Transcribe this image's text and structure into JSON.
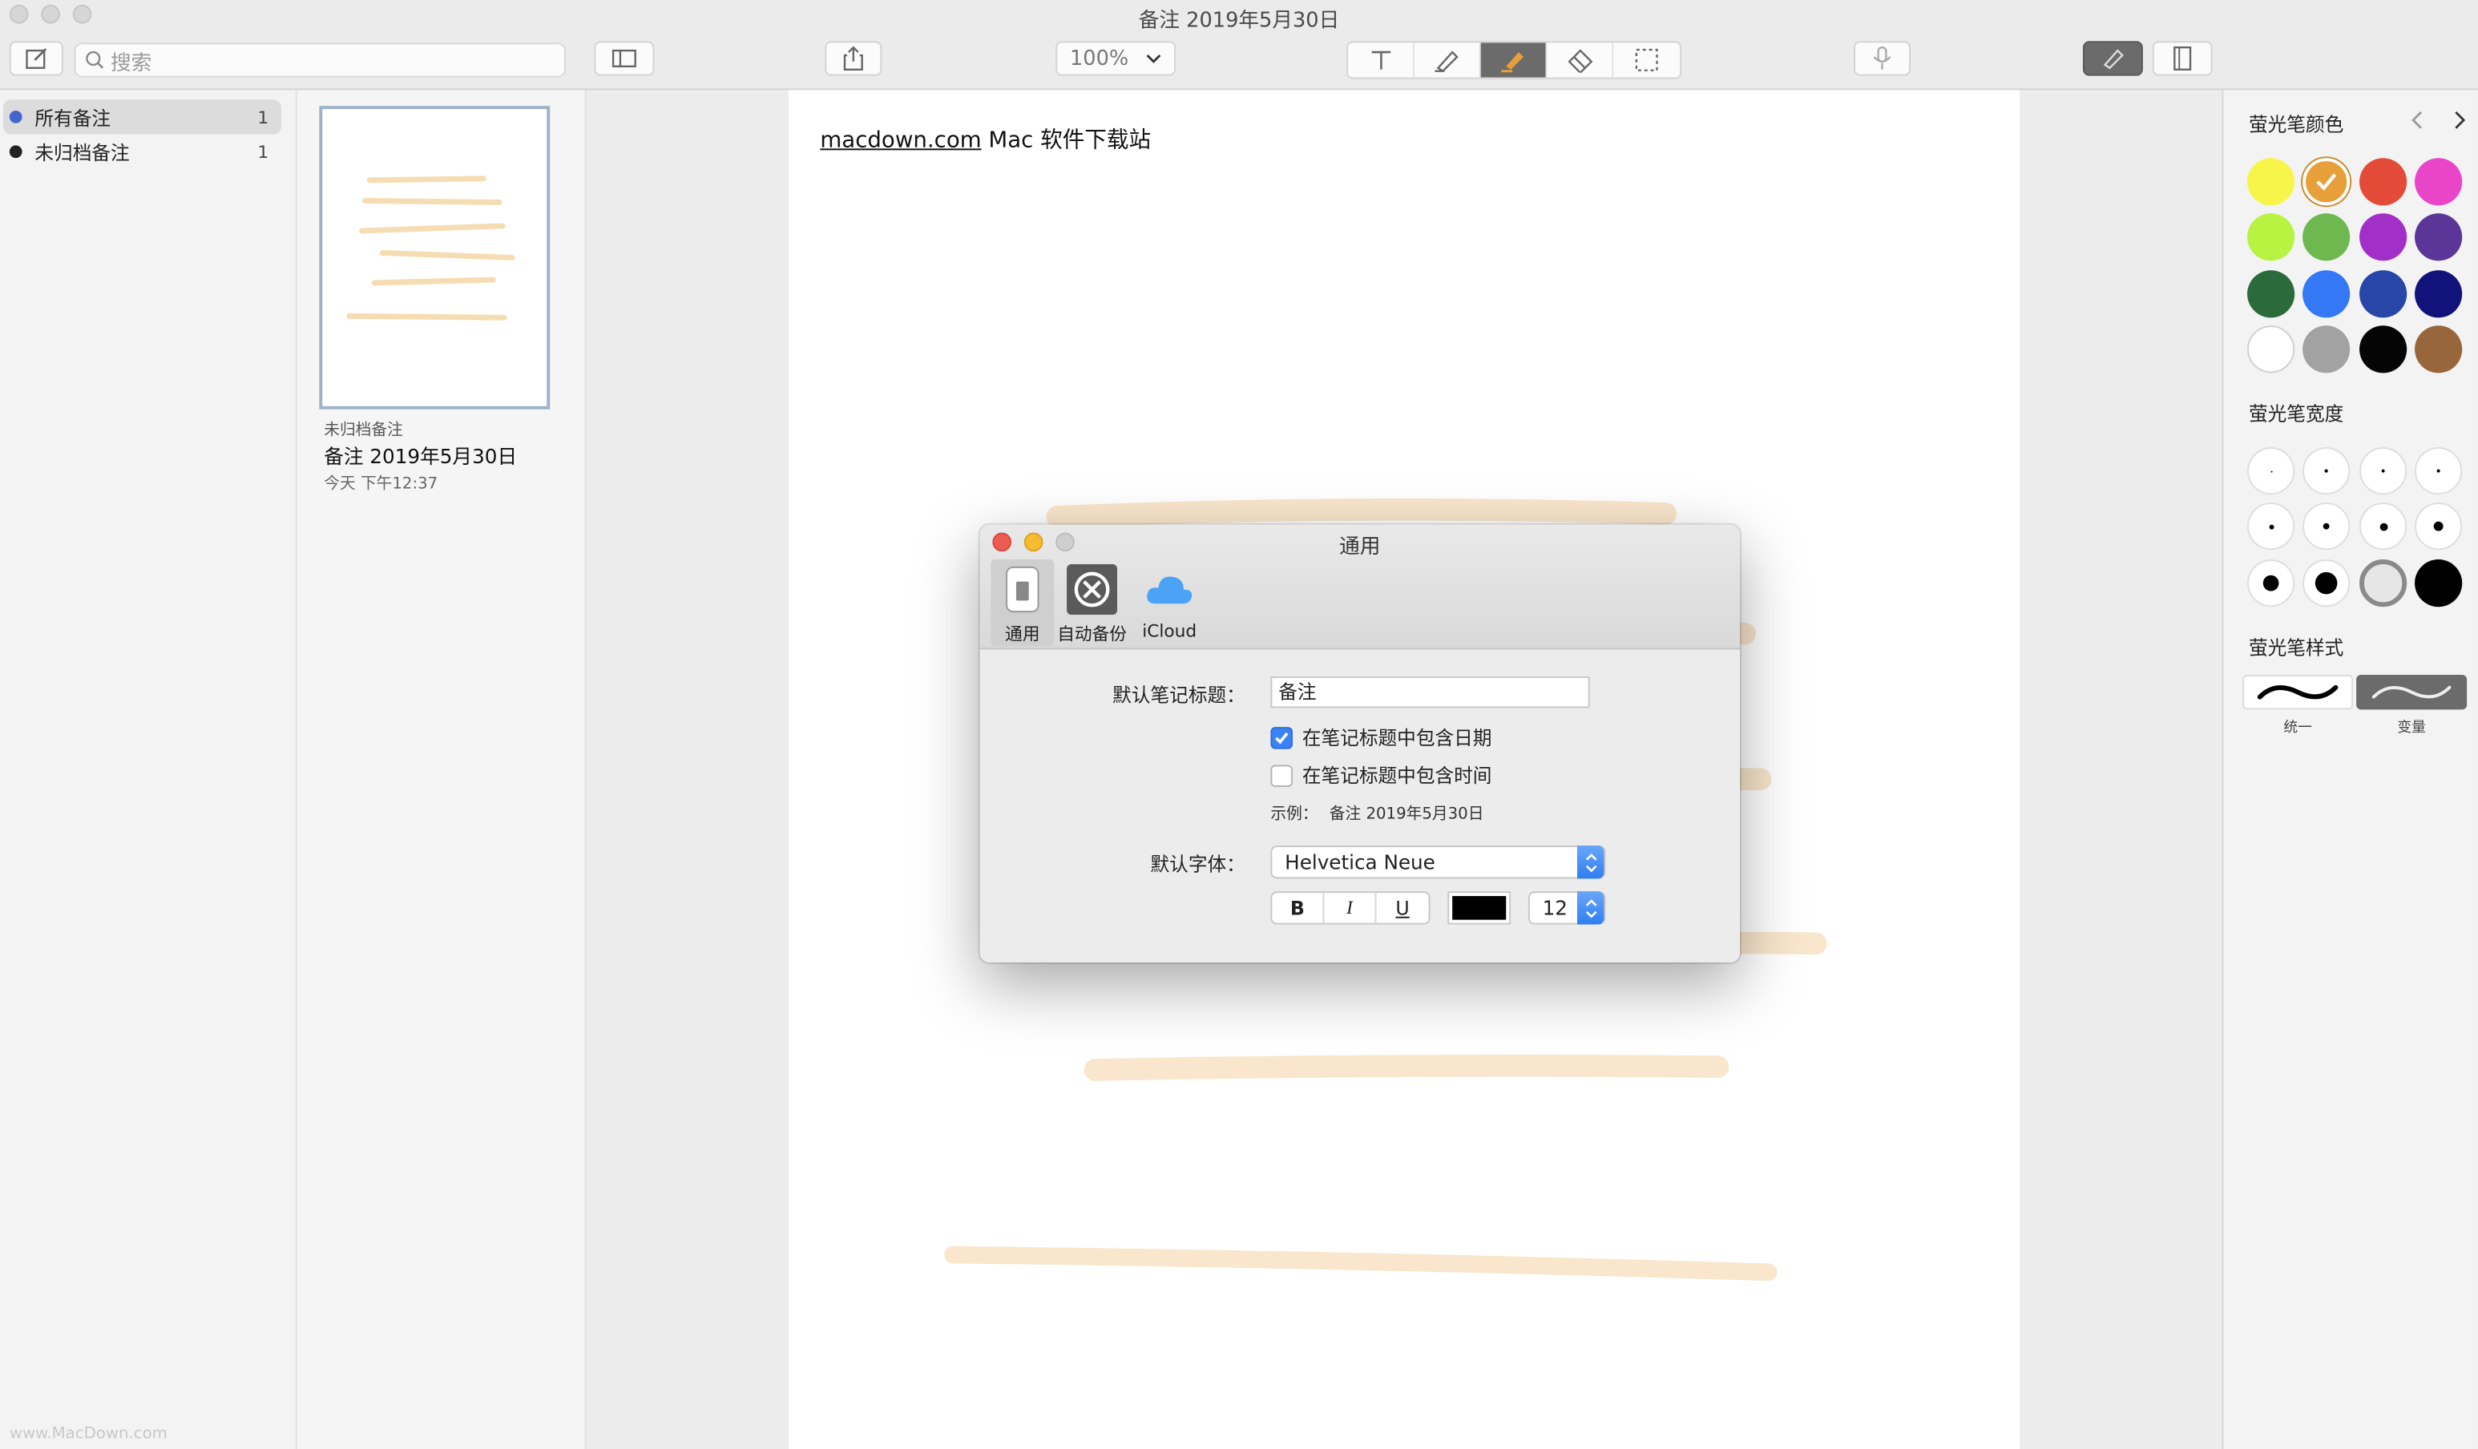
{
  "window": {
    "title": "备注 2019年5月30日"
  },
  "toolbar": {
    "search_placeholder": "搜索",
    "zoom": "100%",
    "colors": {
      "active_tool_bg": "#6b6b6b",
      "toolbar_bg": "#ebebeb"
    }
  },
  "sidebar": {
    "items": [
      {
        "label": "所有备注",
        "count": "1",
        "dot_color": "#4466cc",
        "selected": true
      },
      {
        "label": "未归档备注",
        "count": "1",
        "dot_color": "#222222",
        "selected": false
      }
    ]
  },
  "notelist": {
    "category": "未归档备注",
    "title": "备注 2019年5月30日",
    "time": "今天 下午12:37"
  },
  "page": {
    "link_text": "macdown.com",
    "text_rest": " Mac 软件下载站",
    "stroke_color": "#f9e6cc"
  },
  "inspector": {
    "color_header": "萤光笔颜色",
    "width_header": "萤光笔宽度",
    "style_header": "萤光笔样式",
    "colors": [
      "#f7f54a",
      "#e7a039",
      "#e34a37",
      "#e845c8",
      "#b8f342",
      "#6fb84f",
      "#a22fc8",
      "#5b3597",
      "#2b6a3a",
      "#3478f6",
      "#2846a8",
      "#11127a",
      "#ffffff",
      "#a2a2a2",
      "#050505",
      "#97663a"
    ],
    "selected_color_index": 1,
    "styles": [
      {
        "label": "统一"
      },
      {
        "label": "变量"
      }
    ]
  },
  "dialog": {
    "title": "通用",
    "tabs": [
      {
        "label": "通用",
        "icon": "switch-icon"
      },
      {
        "label": "自动备份",
        "icon": "backup-icon"
      },
      {
        "label": "iCloud",
        "icon": "icloud-icon"
      }
    ],
    "default_title_label": "默认笔记标题：",
    "default_title_value": "备注",
    "include_date_label": "在笔记标题中包含日期",
    "include_date_checked": true,
    "include_time_label": "在笔记标题中包含时间",
    "include_time_checked": false,
    "example_label": "示例：",
    "example_value": "备注 2019年5月30日",
    "font_label": "默认字体：",
    "font_value": "Helvetica Neue",
    "bold": "B",
    "italic": "I",
    "underline": "U",
    "font_color": "#000000",
    "font_size": "12"
  },
  "watermark": "www.MacDown.com"
}
